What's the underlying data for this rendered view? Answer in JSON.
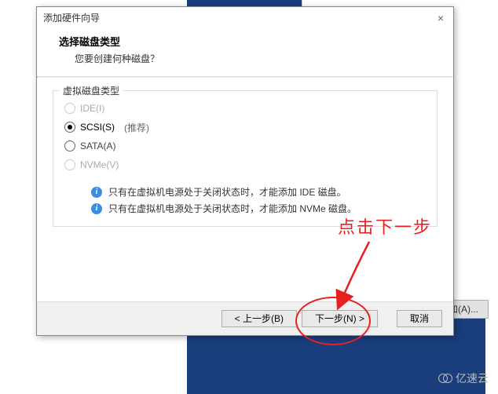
{
  "background": {
    "add_button_label": "添加(A)..."
  },
  "dialog": {
    "title": "添加硬件向导",
    "header_title": "选择磁盘类型",
    "header_sub": "您要创建何种磁盘？",
    "group_legend": "虚拟磁盘类型",
    "radios": {
      "ide": {
        "label": "IDE(I)",
        "enabled": false,
        "selected": false
      },
      "scsi": {
        "label": "SCSI(S)",
        "enabled": true,
        "selected": true,
        "recommend": "(推荐)"
      },
      "sata": {
        "label": "SATA(A)",
        "enabled": true,
        "selected": false
      },
      "nvme": {
        "label": "NVMe(V)",
        "enabled": false,
        "selected": false
      }
    },
    "info1": "只有在虚拟机电源处于关闭状态时，才能添加 IDE 磁盘。",
    "info2": "只有在虚拟机电源处于关闭状态时，才能添加 NVMe 磁盘。",
    "buttons": {
      "back": "< 上一步(B)",
      "next": "下一步(N) >",
      "cancel": "取消"
    }
  },
  "annotation": {
    "text": "点击下一步"
  },
  "watermark": "亿速云"
}
